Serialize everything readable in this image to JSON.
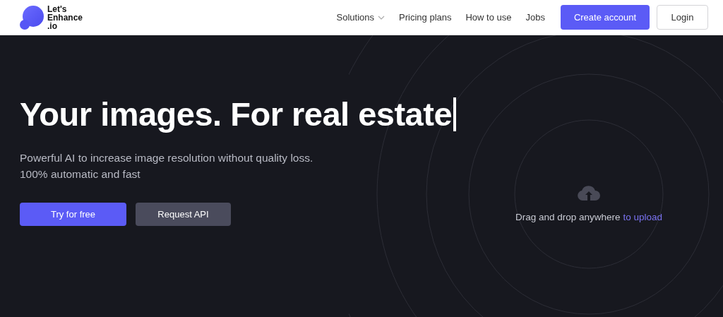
{
  "logo": {
    "lines": [
      "Let's",
      "Enhance",
      ".io"
    ]
  },
  "nav": {
    "items": [
      {
        "label": "Solutions",
        "kind": "dropdown"
      },
      {
        "label": "Pricing plans",
        "kind": "link"
      },
      {
        "label": "How to use",
        "kind": "link"
      },
      {
        "label": "Jobs",
        "kind": "link"
      }
    ],
    "buttons": [
      {
        "label": "Create account",
        "kind": "primary"
      },
      {
        "label": "Login",
        "kind": "outline"
      }
    ]
  },
  "hero": {
    "headline": "Your images. For real estate",
    "subtitle": [
      "Powerful AI to increase image resolution without quality loss.",
      "100% automatic and fast"
    ],
    "buttons": [
      {
        "label": "Try for free",
        "kind": "primary"
      },
      {
        "label": "Request API",
        "kind": "secondary"
      }
    ]
  },
  "upload": {
    "text": "Drag and drop anywhere",
    "link": "to upload"
  }
}
